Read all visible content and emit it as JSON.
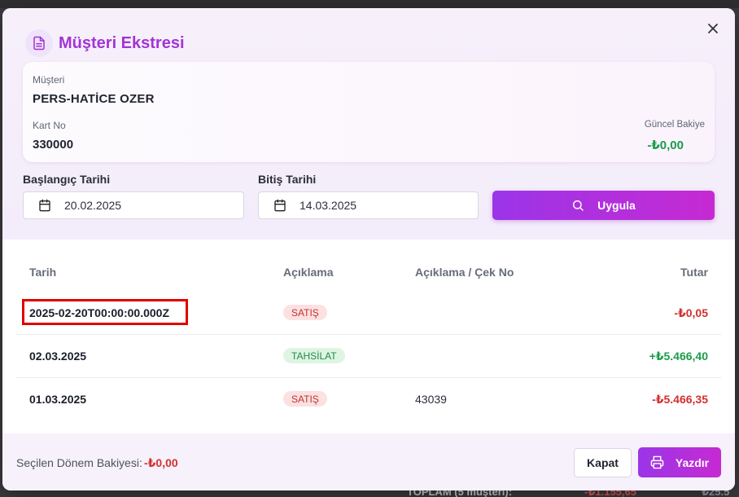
{
  "modal": {
    "title": "Müşteri Ekstresi"
  },
  "customer": {
    "customer_label": "Müşteri",
    "customer_name": "PERS-HATİCE OZER",
    "card_label": "Kart No",
    "card_no": "330000",
    "balance_label": "Güncel Bakiye",
    "balance_value": "-₺0,00"
  },
  "filters": {
    "start_label": "Başlangıç Tarihi",
    "start_value": "20.02.2025",
    "end_label": "Bitiş Tarihi",
    "end_value": "14.03.2025",
    "apply_label": "Uygula"
  },
  "table": {
    "headers": [
      "Tarih",
      "Açıklama",
      "Açıklama / Çek No",
      "Tutar"
    ],
    "rows": [
      {
        "date": "2025-02-20T00:00:00.000Z",
        "type": "SATIŞ",
        "ref": "",
        "amount": "-₺0,05"
      },
      {
        "date": "02.03.2025",
        "type": "TAHSİLAT",
        "ref": "",
        "amount": "+₺5.466,40"
      },
      {
        "date": "01.03.2025",
        "type": "SATIŞ",
        "ref": "43039",
        "amount": "-₺5.466,35"
      }
    ]
  },
  "footer": {
    "period_balance_label": "Seçilen Dönem Bakiyesi:",
    "period_balance_value": "-₺0,00",
    "close_label": "Kapat",
    "print_label": "Yazdır"
  },
  "background": {
    "total_text": "TOPLAM (5 müşteri):",
    "total_neg": "-₺1.155,65",
    "total_right": "₺25.5"
  },
  "colors": {
    "accent": "#a334d6",
    "button_gradient_start": "#9b35e8",
    "button_gradient_end": "#c62ad2",
    "negative": "#d23030",
    "positive": "#1a9c4b",
    "highlight_box": "#e00000"
  },
  "icons": {
    "title_icon": "document-icon",
    "close_icon": "close-icon",
    "calendar_icon": "calendar-icon",
    "search_icon": "search-icon",
    "print_icon": "printer-icon"
  }
}
